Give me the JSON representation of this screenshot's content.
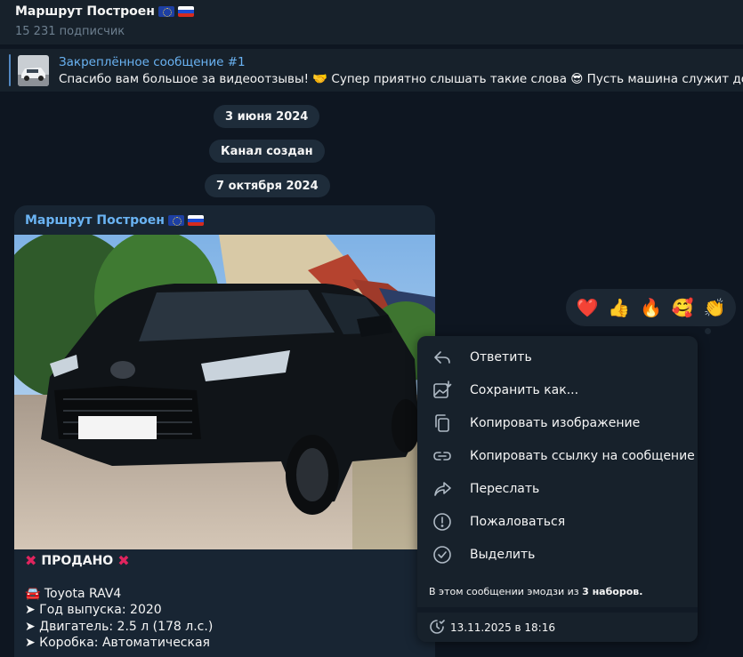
{
  "channel": {
    "title": "Маршрут Построен",
    "subscribers": "15 231 подписчик"
  },
  "pinned": {
    "title": "Закреплённое сообщение #1",
    "text": "Спасибо вам большое за видеоотзывы! 🤝 Супер приятно слышать такие слова 😎 Пусть машина служит долго"
  },
  "date_pills": [
    "3 июня 2024",
    "Канал создан",
    "7 октября 2024"
  ],
  "message": {
    "author": "Маршрут Построен",
    "sold_label": "ПРОДАНО",
    "lines": [
      "🚘 Toyota RAV4",
      "➤ Год выпуска: 2020",
      "➤ Двигатель: 2.5 л (178 л.с.)",
      "➤ Коробка: Автоматическая"
    ]
  },
  "reactions": [
    "❤️",
    "👍",
    "🔥",
    "🥰",
    "👏"
  ],
  "context_menu": {
    "items": [
      {
        "label": "Ответить",
        "icon": "reply-icon"
      },
      {
        "label": "Сохранить как...",
        "icon": "save-image-icon"
      },
      {
        "label": "Копировать изображение",
        "icon": "copy-icon"
      },
      {
        "label": "Копировать ссылку на сообщение",
        "icon": "link-icon"
      },
      {
        "label": "Переслать",
        "icon": "forward-icon"
      },
      {
        "label": "Пожаловаться",
        "icon": "report-icon"
      },
      {
        "label": "Выделить",
        "icon": "select-icon"
      }
    ],
    "emoji_note_prefix": "В этом сообщении эмодзи из ",
    "emoji_note_count": "3 наборов.",
    "timestamp": "13.11.2025 в 18:16"
  },
  "colors": {
    "background": "#0e1621",
    "panel": "#17212b",
    "bubble": "#182533",
    "accent": "#6ab3f3",
    "muted": "#6d7f8f"
  }
}
